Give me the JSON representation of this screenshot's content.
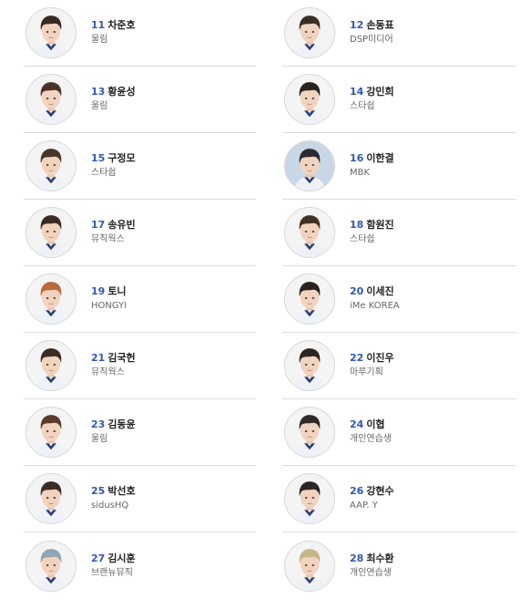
{
  "trainees": [
    {
      "number": "11",
      "name": "차준호",
      "agency": "울림"
    },
    {
      "number": "12",
      "name": "손동표",
      "agency": "DSP미디어"
    },
    {
      "number": "13",
      "name": "황윤성",
      "agency": "울림"
    },
    {
      "number": "14",
      "name": "강민희",
      "agency": "스타쉽"
    },
    {
      "number": "15",
      "name": "구정모",
      "agency": "스타쉽"
    },
    {
      "number": "16",
      "name": "이한결",
      "agency": "MBK"
    },
    {
      "number": "17",
      "name": "송유빈",
      "agency": "뮤직웍스"
    },
    {
      "number": "18",
      "name": "함원진",
      "agency": "스타쉽"
    },
    {
      "number": "19",
      "name": "토니",
      "agency": "HONGYI"
    },
    {
      "number": "20",
      "name": "이세진",
      "agency": "iMe KOREA"
    },
    {
      "number": "21",
      "name": "김국헌",
      "agency": "뮤직웍스"
    },
    {
      "number": "22",
      "name": "이진우",
      "agency": "마루기획"
    },
    {
      "number": "23",
      "name": "김동윤",
      "agency": "울림"
    },
    {
      "number": "24",
      "name": "이협",
      "agency": "개인연습생"
    },
    {
      "number": "25",
      "name": "박선호",
      "agency": "sidusHQ"
    },
    {
      "number": "26",
      "name": "강현수",
      "agency": "AAP. Y"
    },
    {
      "number": "27",
      "name": "김시훈",
      "agency": "브랜뉴뮤직"
    },
    {
      "number": "28",
      "name": "최수환",
      "agency": "개인연습생"
    }
  ],
  "colors": {
    "number_accent": "#2f58b4",
    "name_text": "#222222",
    "agency_text": "#666666",
    "divider": "#dcdcdc"
  },
  "avatar_hair_colors": [
    "#3a2a22",
    "#3b2d25",
    "#4a3326",
    "#2a2320",
    "#4a3428",
    "#2b2a33",
    "#3a2c24",
    "#463224",
    "#b86a3a",
    "#2a2420",
    "#3c2b22",
    "#2c2420",
    "#5a3b2a",
    "#2e2a2a",
    "#3a2c24",
    "#2b2624",
    "#8fa6b3",
    "#c9b48a"
  ],
  "avatar_bg_colors": [
    "#f4f4f4",
    "#f4f4f4",
    "#f4f4f4",
    "#f4f4f4",
    "#f4f4f4",
    "#c9d6e6",
    "#f4f4f4",
    "#f4f4f4",
    "#f4f4f4",
    "#f4f4f4",
    "#f4f4f4",
    "#f4f4f4",
    "#f4f4f4",
    "#f4f4f4",
    "#f4f4f4",
    "#f4f4f4",
    "#f4f4f4",
    "#f4f4f4"
  ]
}
